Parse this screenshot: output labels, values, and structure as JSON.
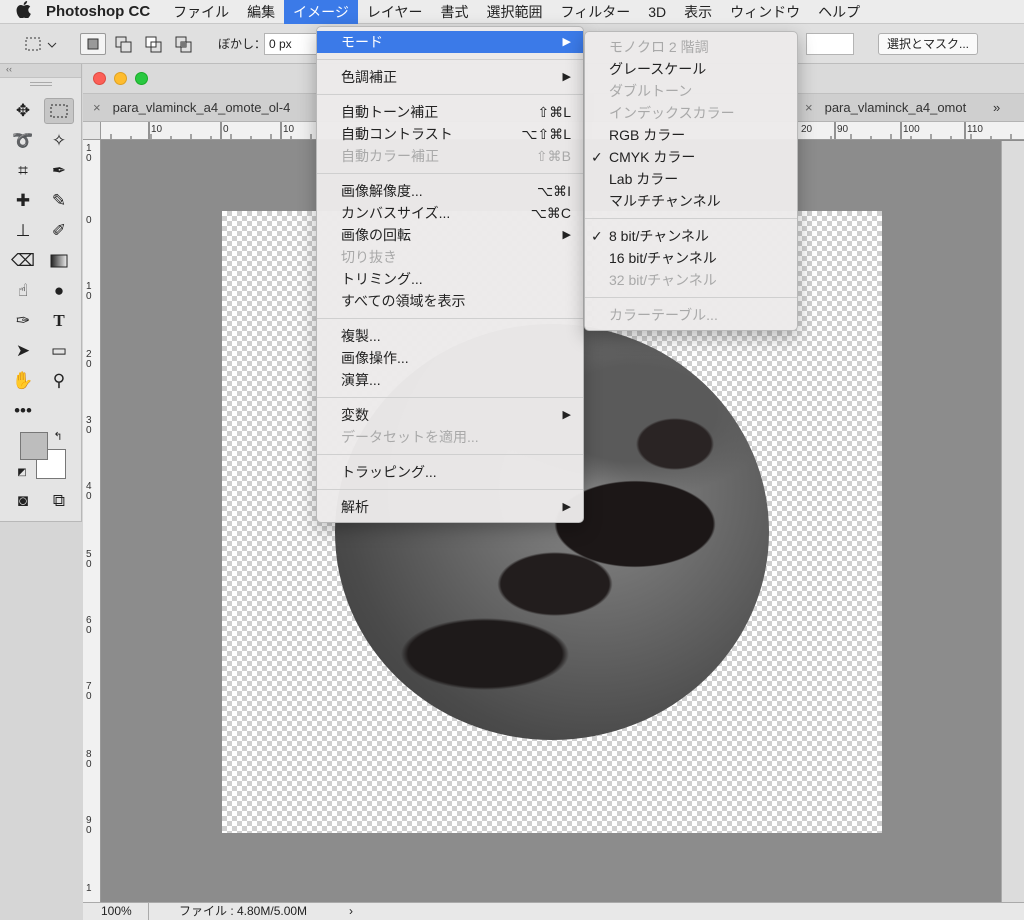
{
  "menubar": {
    "app": "Photoshop CC",
    "items": [
      "ファイル",
      "編集",
      "イメージ",
      "レイヤー",
      "書式",
      "選択範囲",
      "フィルター",
      "3D",
      "表示",
      "ウィンドウ",
      "ヘルプ"
    ]
  },
  "optbar": {
    "blur_label": "ぼかし：",
    "blur_value": "0 px",
    "mask_button": "選択とマスク..."
  },
  "document": {
    "tabs": [
      "para_vlaminck_a4_omote_ol-4",
      "para_vlaminck_a4_omot"
    ],
    "overflow": "»",
    "ruler_top": [
      "10",
      "0",
      "10",
      "20",
      "90",
      "100",
      "110"
    ],
    "ruler_left": [
      "1 0",
      "0",
      "1 0",
      "2 0",
      "3 0",
      "4 0",
      "5 0",
      "6 0",
      "7 0",
      "8 0",
      "9 0",
      "1"
    ],
    "status": {
      "zoom": "100%",
      "file": "ファイル : 4.80M/5.00M",
      "arrow": "›"
    }
  },
  "image_menu": {
    "items": [
      {
        "label": "モード",
        "submenu": true,
        "highlight": true
      },
      {
        "sep": true
      },
      {
        "label": "色調補正",
        "submenu": true
      },
      {
        "sep": true
      },
      {
        "label": "自動トーン補正",
        "shortcut": "⇧⌘L"
      },
      {
        "label": "自動コントラスト",
        "shortcut": "⌥⇧⌘L"
      },
      {
        "label": "自動カラー補正",
        "shortcut": "⇧⌘B",
        "disabled": true
      },
      {
        "sep": true
      },
      {
        "label": "画像解像度...",
        "shortcut": "⌥⌘I"
      },
      {
        "label": "カンバスサイズ...",
        "shortcut": "⌥⌘C"
      },
      {
        "label": "画像の回転",
        "submenu": true
      },
      {
        "label": "切り抜き",
        "disabled": true
      },
      {
        "label": "トリミング..."
      },
      {
        "label": "すべての領域を表示"
      },
      {
        "sep": true
      },
      {
        "label": "複製..."
      },
      {
        "label": "画像操作..."
      },
      {
        "label": "演算..."
      },
      {
        "sep": true
      },
      {
        "label": "変数",
        "submenu": true
      },
      {
        "label": "データセットを適用...",
        "disabled": true
      },
      {
        "sep": true
      },
      {
        "label": "トラッピング..."
      },
      {
        "sep": true
      },
      {
        "label": "解析",
        "submenu": true
      }
    ]
  },
  "mode_submenu": {
    "items": [
      {
        "label": "モノクロ 2 階調",
        "disabled": true
      },
      {
        "label": "グレースケール"
      },
      {
        "label": "ダブルトーン",
        "disabled": true
      },
      {
        "label": "インデックスカラー",
        "disabled": true
      },
      {
        "label": "RGB カラー"
      },
      {
        "label": "CMYK カラー",
        "checked": true
      },
      {
        "label": "Lab カラー"
      },
      {
        "label": "マルチチャンネル"
      },
      {
        "sep": true
      },
      {
        "label": "8 bit/チャンネル",
        "checked": true
      },
      {
        "label": "16 bit/チャンネル"
      },
      {
        "label": "32 bit/チャンネル",
        "disabled": true
      },
      {
        "sep": true
      },
      {
        "label": "カラーテーブル...",
        "disabled": true
      }
    ]
  },
  "icons": {
    "apple": "apple-icon",
    "close": "close-icon",
    "check": "✓"
  }
}
